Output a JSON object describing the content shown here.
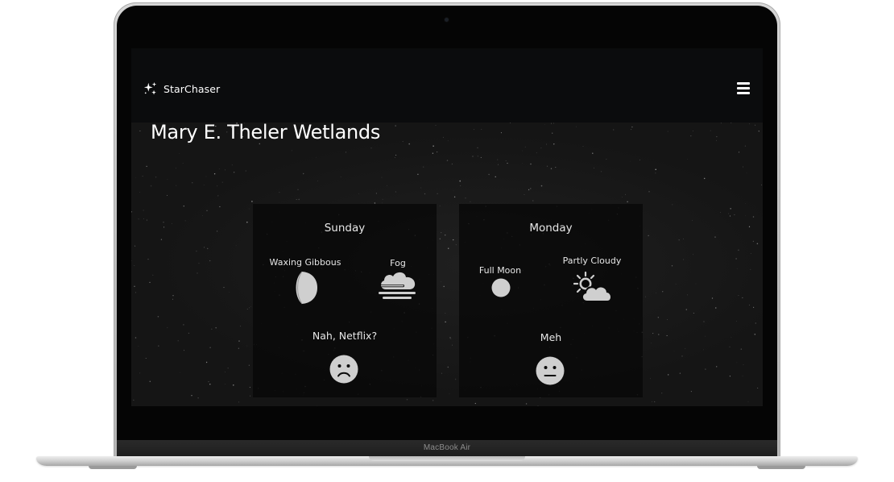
{
  "device": {
    "label": "MacBook Air"
  },
  "app": {
    "brand": "StarChaser",
    "brand_icon": "sparkles-icon",
    "menu_icon": "hamburger-menu-icon"
  },
  "page": {
    "title": "Mary E. Theler Wetlands"
  },
  "forecast": [
    {
      "day": "Sunday",
      "moon_phase": "Waxing Gibbous",
      "moon_icon": "waxing-gibbous-moon-icon",
      "weather": "Fog",
      "weather_icon": "fog-icon",
      "rating": "Nah, Netflix?",
      "rating_icon": "frowning-face-icon"
    },
    {
      "day": "Monday",
      "moon_phase": "Full Moon",
      "moon_icon": "full-moon-icon",
      "weather": "Partly Cloudy",
      "weather_icon": "partly-cloudy-icon",
      "rating": "Meh",
      "rating_icon": "neutral-face-icon"
    }
  ],
  "colors": {
    "navbar": "#0b0c0d",
    "card": "#080808",
    "text": "#ffffff",
    "icon": "#cfcfcf"
  }
}
